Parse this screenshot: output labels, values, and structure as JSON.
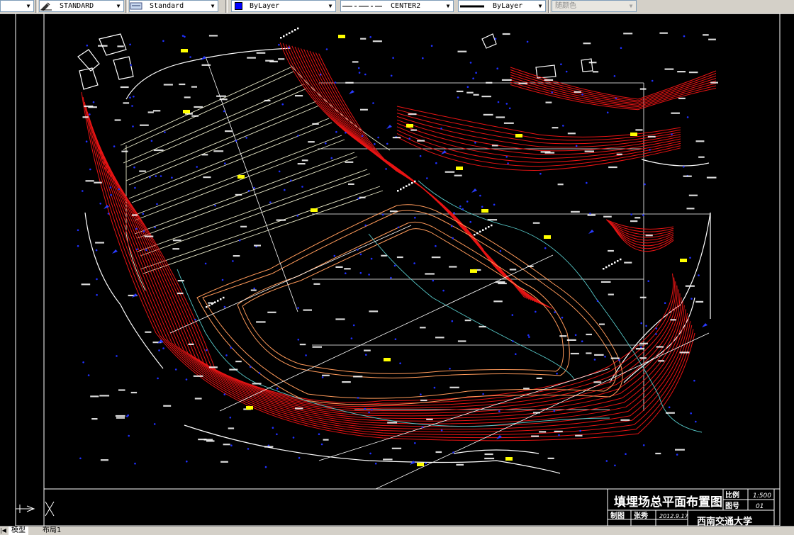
{
  "toolbar": {
    "text_style": "STANDARD",
    "dim_style": "Standard",
    "layer": "ByLayer",
    "layer_color": "#0000ff",
    "linetype": "CENTER2",
    "lineweight": "ByLayer",
    "plot_color": "随颜色"
  },
  "title_block": {
    "drawing_title": "填埋场总平面布置图",
    "scale_label": "比例",
    "scale_value": "1:500",
    "sheet_label": "图号",
    "sheet_value": "01",
    "drawn_label": "制图",
    "drawn_value": "张秀",
    "date_value": "2012.9.17",
    "school": "西南交通大学"
  },
  "tabs": [
    "模型",
    "布局1"
  ],
  "colors": {
    "background": "#000000",
    "contour": "#e81414",
    "contour_major": "#ff9a5a",
    "boundary": "#ffffff",
    "road": "#e8e8c8",
    "stream": "#56c8c8",
    "marker": "#ffff00",
    "point": "#2030ff",
    "label": "#ffffff"
  }
}
